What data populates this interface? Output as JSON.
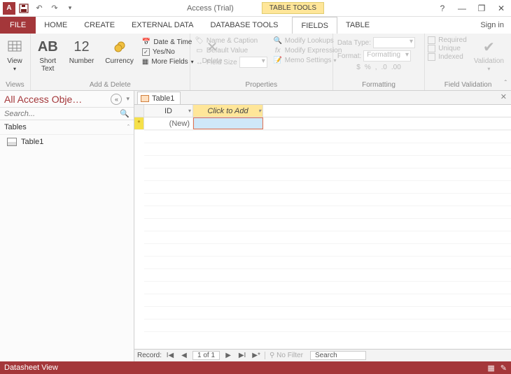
{
  "titlebar": {
    "app_title": "Access (Trial)",
    "table_tools": "TABLE TOOLS",
    "sign_in": "Sign in"
  },
  "tabs": {
    "file": "FILE",
    "home": "HOME",
    "create": "CREATE",
    "external": "EXTERNAL DATA",
    "dbtools": "DATABASE TOOLS",
    "fields": "FIELDS",
    "table": "TABLE"
  },
  "ribbon": {
    "views": {
      "view": "View",
      "group": "Views"
    },
    "addDelete": {
      "short_text": "Short\nText",
      "number": "Number",
      "currency": "Currency",
      "date_time": "Date & Time",
      "yes_no": "Yes/No",
      "more_fields": "More Fields",
      "delete": "Delete",
      "group": "Add & Delete",
      "ab": "AB",
      "twelve": "12"
    },
    "properties": {
      "name_caption": "Name & Caption",
      "default_value": "Default Value",
      "field_size": "Field Size",
      "modify_lookups": "Modify Lookups",
      "modify_expression": "Modify Expression",
      "memo_settings": "Memo Settings",
      "group": "Properties"
    },
    "formatting": {
      "data_type": "Data Type:",
      "format": "Format:",
      "format_val": "Formatting",
      "group": "Formatting"
    },
    "fieldValidation": {
      "required": "Required",
      "unique": "Unique",
      "indexed": "Indexed",
      "validation": "Validation",
      "group": "Field Validation"
    }
  },
  "nav": {
    "title": "All Access Obje…",
    "search_placeholder": "Search...",
    "category": "Tables",
    "items": [
      "Table1"
    ]
  },
  "doc": {
    "tab": "Table1",
    "columns": {
      "id": "ID",
      "add": "Click to Add"
    },
    "row_new": "(New)"
  },
  "recordnav": {
    "label": "Record:",
    "position": "1 of 1",
    "no_filter": "No Filter",
    "search": "Search"
  },
  "status": {
    "view": "Datasheet View"
  }
}
